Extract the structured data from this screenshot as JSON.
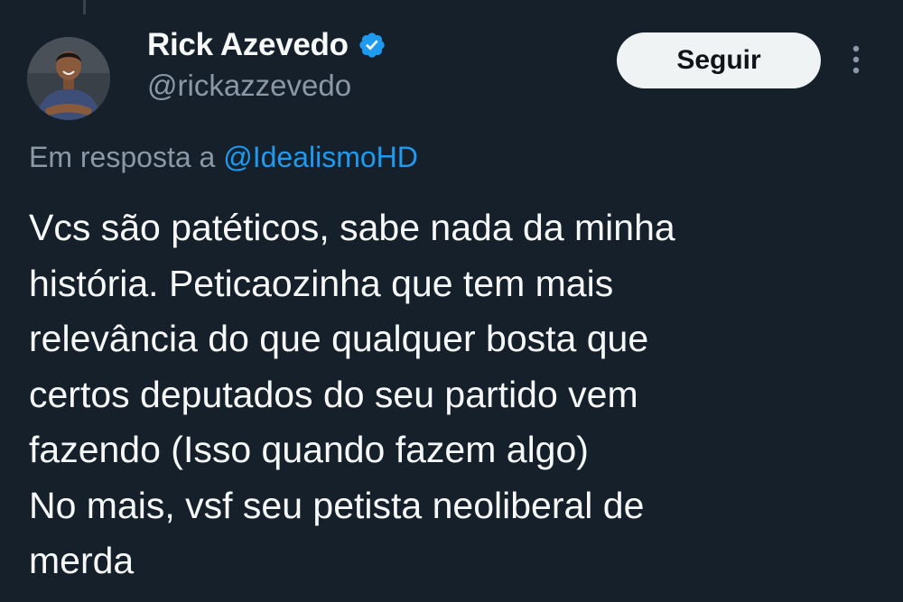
{
  "tweet": {
    "author": {
      "display_name": "Rick Azevedo",
      "handle": "@rickazzevedo",
      "verified": true
    },
    "follow_button_label": "Seguir",
    "reply_prefix": "Em resposta a",
    "reply_to_handle": "@IdealismoHD",
    "text": "Vcs são patéticos, sabe nada da minha\nhistória. Peticaozinha que tem mais\nrelevância do que qualquer bosta que\ncertos deputados do seu partido vem\nfazendo (Isso quando fazem algo)\nNo mais, vsf seu petista neoliberal de\nmerda"
  },
  "icons": {
    "verified": "verified-badge-icon",
    "more": "more-options-icon"
  },
  "colors": {
    "background": "#15202b",
    "text_primary": "#f7f9f9",
    "text_secondary": "#8b98a5",
    "accent": "#1d9bf0",
    "button_bg": "#eff3f4",
    "button_text": "#0f1419"
  }
}
